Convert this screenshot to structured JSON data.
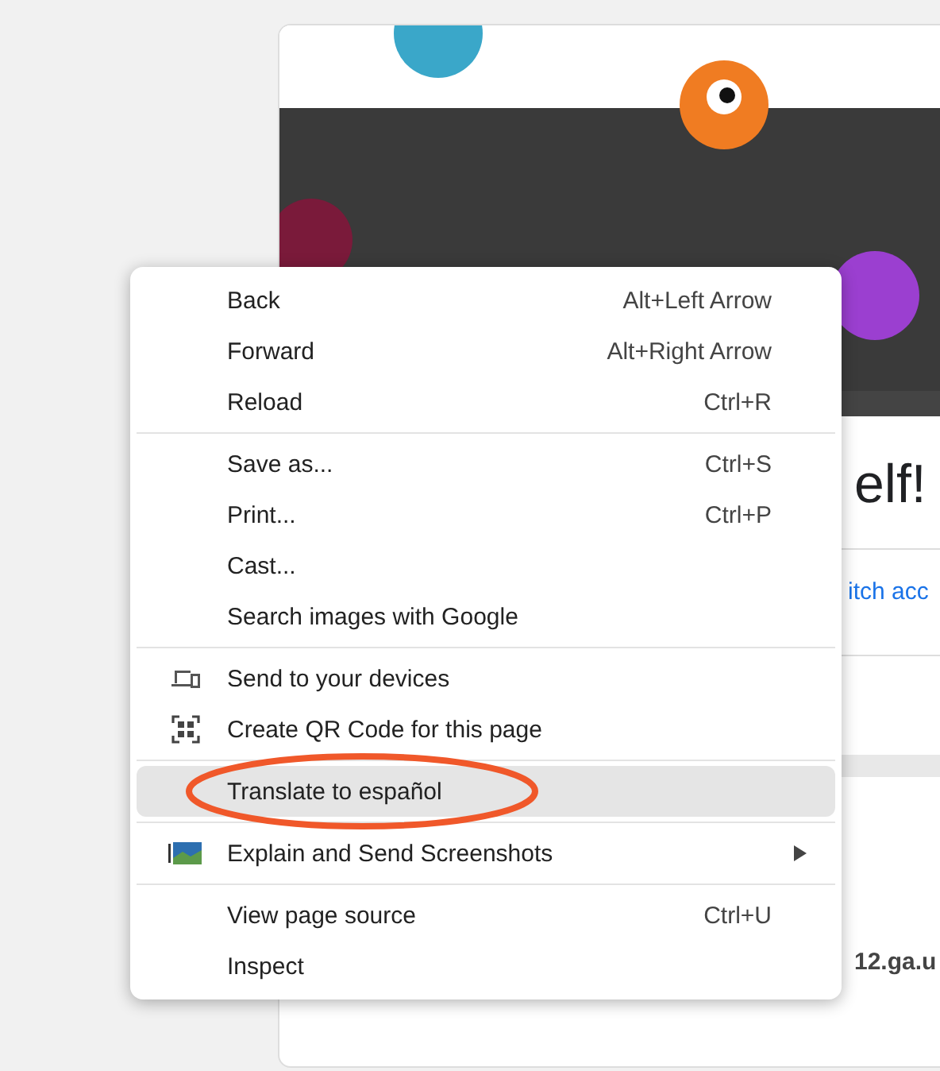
{
  "page": {
    "heading": "elf!",
    "link": "itch acc",
    "url_text": "12.ga.u"
  },
  "context_menu": {
    "groups": [
      {
        "items": [
          {
            "label": "Back",
            "shortcut": "Alt+Left Arrow"
          },
          {
            "label": "Forward",
            "shortcut": "Alt+Right Arrow"
          },
          {
            "label": "Reload",
            "shortcut": "Ctrl+R"
          }
        ]
      },
      {
        "items": [
          {
            "label": "Save as...",
            "shortcut": "Ctrl+S"
          },
          {
            "label": "Print...",
            "shortcut": "Ctrl+P"
          },
          {
            "label": "Cast..."
          },
          {
            "label": "Search images with Google"
          }
        ]
      },
      {
        "items": [
          {
            "label": "Send to your devices"
          },
          {
            "label": "Create QR Code for this page"
          }
        ]
      },
      {
        "items": [
          {
            "label": "Translate to español",
            "selected": true,
            "circled": true
          }
        ]
      },
      {
        "items": [
          {
            "label": "Explain and Send Screenshots",
            "submenu": true
          }
        ]
      },
      {
        "items": [
          {
            "label": "View page source",
            "shortcut": "Ctrl+U"
          },
          {
            "label": "Inspect"
          }
        ]
      }
    ]
  }
}
